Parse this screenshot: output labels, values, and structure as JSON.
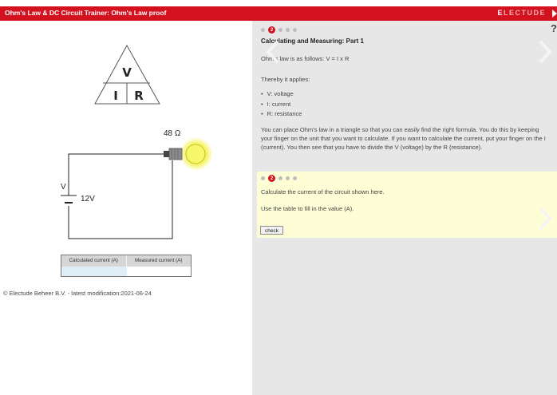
{
  "header": {
    "title": "Ohm's Law & DC Circuit Trainer: Ohm's Law proof",
    "brand_prefix": "E",
    "brand_rest": "LECTUDE"
  },
  "triangle": {
    "top": "V",
    "bottom_left": "I",
    "bottom_right": "R"
  },
  "circuit": {
    "resistance_label": "48 Ω",
    "source_symbol": "V",
    "voltage_label": "12V"
  },
  "table": {
    "headers": [
      "Calculated current (A)",
      "Measured current (A)"
    ],
    "calculated_value": "",
    "measured_value": ""
  },
  "footer": "© Electude Beheer B.V. - latest modification:2021-06-24",
  "panel1": {
    "step": "2",
    "title": "Calculating and Measuring: Part 1",
    "line1": "Ohm's law is as follows: V = I x R",
    "line2": "Thereby it applies:",
    "bullets": [
      "V: voltage",
      "I: current",
      "R: resistance"
    ],
    "paragraph": "You can place Ohm's law in a triangle so that you can easily find the right formula. You do this by keeping your finger on the unit that you want to calculate. If you want to calculate the current, put your finger on the I (current). You then see that you have to divide the V (voltage) by the R (resistance)."
  },
  "panel2": {
    "step": "2",
    "line1": "Calculate the current of the circuit shown here.",
    "line2": "Use the table to fill in the value (A).",
    "check_label": "check"
  },
  "help_label": "?",
  "colors": {
    "header_red": "#d4111e",
    "panel_bg": "#e7e7e7",
    "question_bg": "#fefed6",
    "input_bg": "#e0eef8",
    "bulb_glow": "#f5f35a"
  }
}
